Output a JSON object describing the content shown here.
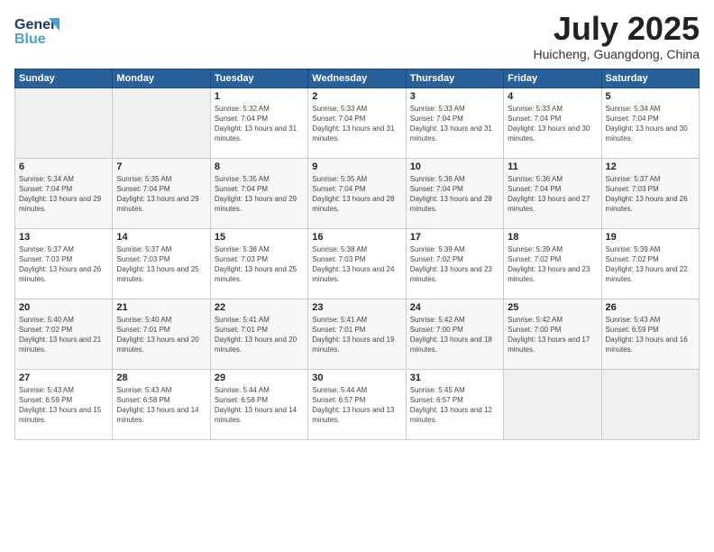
{
  "header": {
    "logo_line1": "General",
    "logo_line2": "Blue",
    "month_title": "July 2025",
    "location": "Huicheng, Guangdong, China"
  },
  "weekdays": [
    "Sunday",
    "Monday",
    "Tuesday",
    "Wednesday",
    "Thursday",
    "Friday",
    "Saturday"
  ],
  "weeks": [
    [
      {
        "day": "",
        "empty": true
      },
      {
        "day": "",
        "empty": true
      },
      {
        "day": "1",
        "sunrise": "5:32 AM",
        "sunset": "7:04 PM",
        "daylight": "13 hours and 31 minutes."
      },
      {
        "day": "2",
        "sunrise": "5:33 AM",
        "sunset": "7:04 PM",
        "daylight": "13 hours and 31 minutes."
      },
      {
        "day": "3",
        "sunrise": "5:33 AM",
        "sunset": "7:04 PM",
        "daylight": "13 hours and 31 minutes."
      },
      {
        "day": "4",
        "sunrise": "5:33 AM",
        "sunset": "7:04 PM",
        "daylight": "13 hours and 30 minutes."
      },
      {
        "day": "5",
        "sunrise": "5:34 AM",
        "sunset": "7:04 PM",
        "daylight": "13 hours and 30 minutes."
      }
    ],
    [
      {
        "day": "6",
        "sunrise": "5:34 AM",
        "sunset": "7:04 PM",
        "daylight": "13 hours and 29 minutes."
      },
      {
        "day": "7",
        "sunrise": "5:35 AM",
        "sunset": "7:04 PM",
        "daylight": "13 hours and 29 minutes."
      },
      {
        "day": "8",
        "sunrise": "5:35 AM",
        "sunset": "7:04 PM",
        "daylight": "13 hours and 29 minutes."
      },
      {
        "day": "9",
        "sunrise": "5:35 AM",
        "sunset": "7:04 PM",
        "daylight": "13 hours and 28 minutes."
      },
      {
        "day": "10",
        "sunrise": "5:36 AM",
        "sunset": "7:04 PM",
        "daylight": "13 hours and 28 minutes."
      },
      {
        "day": "11",
        "sunrise": "5:36 AM",
        "sunset": "7:04 PM",
        "daylight": "13 hours and 27 minutes."
      },
      {
        "day": "12",
        "sunrise": "5:37 AM",
        "sunset": "7:03 PM",
        "daylight": "13 hours and 26 minutes."
      }
    ],
    [
      {
        "day": "13",
        "sunrise": "5:37 AM",
        "sunset": "7:03 PM",
        "daylight": "13 hours and 26 minutes."
      },
      {
        "day": "14",
        "sunrise": "5:37 AM",
        "sunset": "7:03 PM",
        "daylight": "13 hours and 25 minutes."
      },
      {
        "day": "15",
        "sunrise": "5:38 AM",
        "sunset": "7:03 PM",
        "daylight": "13 hours and 25 minutes."
      },
      {
        "day": "16",
        "sunrise": "5:38 AM",
        "sunset": "7:03 PM",
        "daylight": "13 hours and 24 minutes."
      },
      {
        "day": "17",
        "sunrise": "5:39 AM",
        "sunset": "7:02 PM",
        "daylight": "13 hours and 23 minutes."
      },
      {
        "day": "18",
        "sunrise": "5:39 AM",
        "sunset": "7:02 PM",
        "daylight": "13 hours and 23 minutes."
      },
      {
        "day": "19",
        "sunrise": "5:39 AM",
        "sunset": "7:02 PM",
        "daylight": "13 hours and 22 minutes."
      }
    ],
    [
      {
        "day": "20",
        "sunrise": "5:40 AM",
        "sunset": "7:02 PM",
        "daylight": "13 hours and 21 minutes."
      },
      {
        "day": "21",
        "sunrise": "5:40 AM",
        "sunset": "7:01 PM",
        "daylight": "13 hours and 20 minutes."
      },
      {
        "day": "22",
        "sunrise": "5:41 AM",
        "sunset": "7:01 PM",
        "daylight": "13 hours and 20 minutes."
      },
      {
        "day": "23",
        "sunrise": "5:41 AM",
        "sunset": "7:01 PM",
        "daylight": "13 hours and 19 minutes."
      },
      {
        "day": "24",
        "sunrise": "5:42 AM",
        "sunset": "7:00 PM",
        "daylight": "13 hours and 18 minutes."
      },
      {
        "day": "25",
        "sunrise": "5:42 AM",
        "sunset": "7:00 PM",
        "daylight": "13 hours and 17 minutes."
      },
      {
        "day": "26",
        "sunrise": "5:43 AM",
        "sunset": "6:59 PM",
        "daylight": "13 hours and 16 minutes."
      }
    ],
    [
      {
        "day": "27",
        "sunrise": "5:43 AM",
        "sunset": "6:59 PM",
        "daylight": "13 hours and 15 minutes."
      },
      {
        "day": "28",
        "sunrise": "5:43 AM",
        "sunset": "6:58 PM",
        "daylight": "13 hours and 14 minutes."
      },
      {
        "day": "29",
        "sunrise": "5:44 AM",
        "sunset": "6:58 PM",
        "daylight": "13 hours and 14 minutes."
      },
      {
        "day": "30",
        "sunrise": "5:44 AM",
        "sunset": "6:57 PM",
        "daylight": "13 hours and 13 minutes."
      },
      {
        "day": "31",
        "sunrise": "5:45 AM",
        "sunset": "6:57 PM",
        "daylight": "13 hours and 12 minutes."
      },
      {
        "day": "",
        "empty": true
      },
      {
        "day": "",
        "empty": true
      }
    ]
  ]
}
